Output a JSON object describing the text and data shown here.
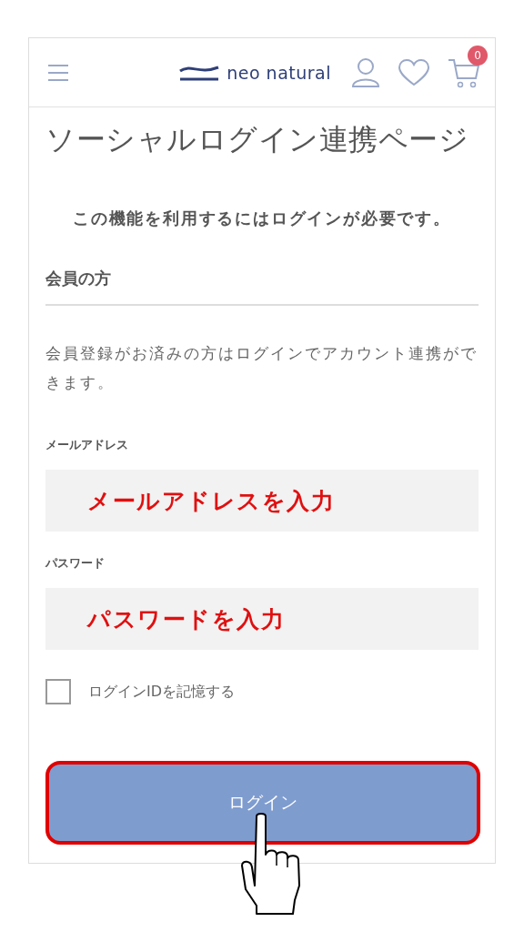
{
  "header": {
    "logo": "neo natural",
    "cart_count": "0"
  },
  "title": "ソーシャルログイン連携ページ",
  "notice": "この機能を利用するにはログインが必要です。",
  "section": {
    "heading": "会員の方",
    "description": "会員登録がお済みの方はログインでアカウント連携ができます。"
  },
  "fields": [
    {
      "label": "メールアドレス",
      "annotation": "メールアドレスを入力"
    },
    {
      "label": "パスワード",
      "annotation": "パスワードを入力"
    }
  ],
  "remember": {
    "label": "ログインIDを記憶する",
    "checked": false
  },
  "login_button": {
    "label": "ログイン",
    "highlighted": true
  }
}
